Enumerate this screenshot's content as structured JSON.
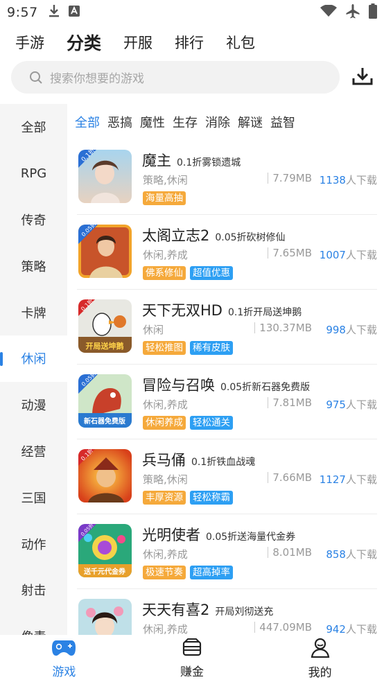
{
  "status_bar": {
    "time": "9:57"
  },
  "top_tabs": [
    {
      "label": "手游",
      "active": false
    },
    {
      "label": "分类",
      "active": true
    },
    {
      "label": "开服",
      "active": false
    },
    {
      "label": "排行",
      "active": false
    },
    {
      "label": "礼包",
      "active": false
    }
  ],
  "search": {
    "placeholder": "搜索你想要的游戏"
  },
  "sidebar": {
    "items": [
      "全部",
      "RPG",
      "传奇",
      "策略",
      "卡牌",
      "休闲",
      "动漫",
      "经营",
      "三国",
      "动作",
      "射击",
      "像素"
    ],
    "active_index": 5
  },
  "subcategories": {
    "items": [
      "全部",
      "恶搞",
      "魔性",
      "生存",
      "消除",
      "解谜",
      "益智"
    ],
    "active_index": 0
  },
  "games": [
    {
      "name": "魔主",
      "promo": "0.1折雾锁遗城",
      "tags": "策略,休闲",
      "size": "7.79MB",
      "downloads": "1138",
      "dl_suffix": "人下载",
      "icon_label": "0.1折",
      "badges": [
        {
          "text": "海量高抽",
          "color": "orange"
        }
      ]
    },
    {
      "name": "太阁立志2",
      "promo": "0.05折砍树修仙",
      "tags": "休闲,养成",
      "size": "7.65MB",
      "downloads": "1007",
      "dl_suffix": "人下载",
      "icon_label": "0.05折",
      "badges": [
        {
          "text": "佛系修仙",
          "color": "orange"
        },
        {
          "text": "超值优惠",
          "color": "blue"
        }
      ]
    },
    {
      "name": "天下无双HD",
      "promo": "0.1折开局送坤鹅",
      "tags": "休闲",
      "size": "130.37MB",
      "downloads": "998",
      "dl_suffix": "人下载",
      "icon_label": "0.1折",
      "icon_caption": "开局送坤鹅",
      "badges": [
        {
          "text": "轻松推图",
          "color": "orange"
        },
        {
          "text": "稀有皮肤",
          "color": "blue"
        }
      ]
    },
    {
      "name": "冒险与召唤",
      "promo": "0.05折新石器免费版",
      "tags": "休闲,养成",
      "size": "7.81MB",
      "downloads": "975",
      "dl_suffix": "人下载",
      "icon_label": "0.05折",
      "icon_caption": "新石器免费版",
      "badges": [
        {
          "text": "休闲养成",
          "color": "orange"
        },
        {
          "text": "轻松通关",
          "color": "blue"
        }
      ]
    },
    {
      "name": "兵马俑",
      "promo": "0.1折铁血战魂",
      "tags": "策略,休闲",
      "size": "7.66MB",
      "downloads": "1127",
      "dl_suffix": "人下载",
      "icon_label": "0.1折",
      "badges": [
        {
          "text": "丰厚资源",
          "color": "orange"
        },
        {
          "text": "轻松称霸",
          "color": "blue"
        }
      ]
    },
    {
      "name": "光明使者",
      "promo": "0.05折送海量代金券",
      "tags": "休闲,养成",
      "size": "8.01MB",
      "downloads": "858",
      "dl_suffix": "人下载",
      "icon_label": "0.05折",
      "icon_caption": "送千元代金券",
      "badges": [
        {
          "text": "极速节奏",
          "color": "orange"
        },
        {
          "text": "超高掉率",
          "color": "blue"
        }
      ]
    },
    {
      "name": "天天有喜2",
      "promo": "开局刘彻送充",
      "tags": "休闲,养成",
      "size": "447.09MB",
      "downloads": "942",
      "dl_suffix": "人下载",
      "icon_label": "",
      "badges": []
    }
  ],
  "bottom_nav": [
    {
      "label": "游戏",
      "active": true
    },
    {
      "label": "赚金",
      "active": false
    },
    {
      "label": "我的",
      "active": false
    }
  ],
  "colors": {
    "accent": "#2b82e4",
    "badge_orange": "#f5a93b",
    "badge_blue": "#2d9ff3"
  }
}
